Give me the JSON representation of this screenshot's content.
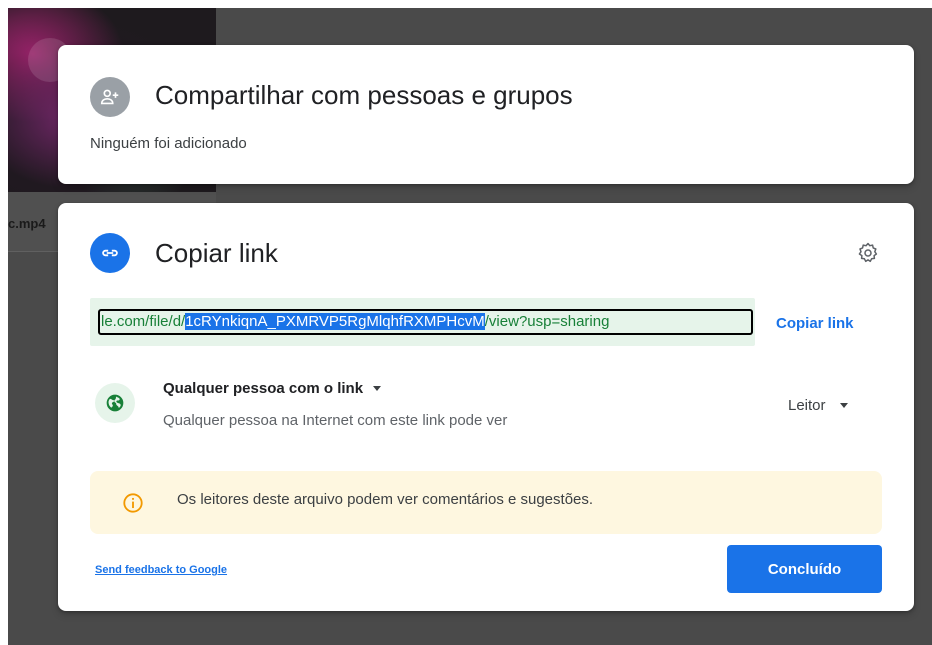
{
  "background": {
    "filename": "c.mp4"
  },
  "share_dialog": {
    "icon": "person-add-icon",
    "title": "Compartilhar com pessoas e grupos",
    "subtitle": "Ninguém foi adicionado"
  },
  "link_dialog": {
    "icon": "link-icon",
    "title": "Copiar link",
    "settings_icon": "gear-icon",
    "link": {
      "prefix": "le.com/file/d/",
      "selected": "1cRYnkiqnA_PXMRVP5RgMlqhfRXMPHcvM",
      "suffix": "/view?usp=sharing"
    },
    "copy_button": "Copiar link",
    "access": {
      "icon": "globe-icon",
      "label": "Qualquer pessoa com o link",
      "description": "Qualquer pessoa na Internet com este link pode ver",
      "role": "Leitor"
    },
    "info": {
      "icon": "info-icon",
      "text": "Os leitores deste arquivo podem ver comentários e sugestões."
    },
    "feedback_link": "Send feedback to Google",
    "done_button": "Concluído"
  },
  "colors": {
    "accent": "#1a73e8",
    "link_bg": "#e6f4ea",
    "link_text": "#188038",
    "info_bg": "#fef7e0",
    "info_icon": "#f29900"
  }
}
